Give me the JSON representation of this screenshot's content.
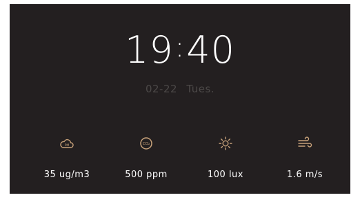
{
  "clock": {
    "hours": "19",
    "separator": ":",
    "minutes": "40",
    "date": "02-22",
    "weekday": "Tues."
  },
  "sensors": [
    {
      "icon": "pm-cloud-icon",
      "value": "35 ug/m3"
    },
    {
      "icon": "co2-icon",
      "value": "500 ppm"
    },
    {
      "icon": "sun-icon",
      "value": "100 lux"
    },
    {
      "icon": "wind-icon",
      "value": "1.6 m/s"
    }
  ],
  "colors": {
    "background": "#231f20",
    "accent": "#c8a27a",
    "text": "#ffffff",
    "muted": "#4c4948"
  }
}
